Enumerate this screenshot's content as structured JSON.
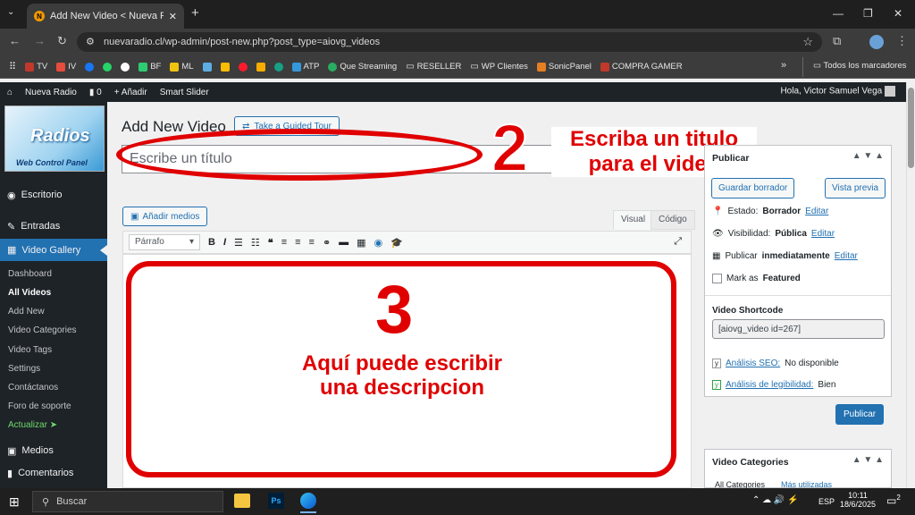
{
  "browser": {
    "tab_title": "Add New Video < Nueva Radio",
    "tab_favicon": "N",
    "new_tab": "+",
    "url": "nuevaradio.cl/wp-admin/post-new.php?post_type=aiovg_videos",
    "bookmarks": [
      "TV",
      "IV",
      "BF",
      "ML",
      "ATP",
      "Que Streaming",
      "RESELLER",
      "WP Clientes",
      "SonicPanel",
      "COMPRA GAMER"
    ],
    "bookmarks_more": "»",
    "all_bookmarks": "Todos los marcadores"
  },
  "adminbar": {
    "site": "Nueva Radio",
    "comments": "0",
    "new": "Añadir",
    "smart": "Smart Slider",
    "greeting": "Hola, Victor Samuel Vega"
  },
  "logo": {
    "text": "Radios",
    "subtitle": "Web Control Panel"
  },
  "sidebar": {
    "escritorio": "Escritorio",
    "entradas": "Entradas",
    "video_gallery": "Video Gallery",
    "subitems": [
      "Dashboard",
      "All Videos",
      "Add New",
      "Video Categories",
      "Video Tags",
      "Settings",
      "Contáctanos",
      "Foro de soporte"
    ],
    "actualizar": "Actualizar",
    "medios": "Medios",
    "comentarios": "Comentarios"
  },
  "main": {
    "heading": "Add New Video",
    "tour": "Take a Guided Tour",
    "title_placeholder": "Escribe un título",
    "add_media": "Añadir medios",
    "tab_visual": "Visual",
    "tab_code": "Código",
    "format": "Párrafo"
  },
  "annotations": {
    "num2": "2",
    "text2_line1": "Escriba un titulo",
    "text2_line2": "para el video",
    "num3": "3",
    "text3_line1": "Aquí puede escribir",
    "text3_line2": "una descripcion"
  },
  "publish": {
    "title": "Publicar",
    "save_draft": "Guardar borrador",
    "preview": "Vista previa",
    "status_label": "Estado:",
    "status_value": "Borrador",
    "edit": "Editar",
    "visibility_label": "Visibilidad:",
    "visibility_value": "Pública",
    "publish_label": "Publicar",
    "publish_value": "inmediatamente",
    "featured_pre": "Mark as",
    "featured": "Featured",
    "shortcode_label": "Video Shortcode",
    "shortcode_value": "[aiovg_video id=267]",
    "seo_label": "Análisis SEO:",
    "seo_value": "No disponible",
    "read_label": "Análisis de legibilidad:",
    "read_value": "Bien",
    "publish_btn": "Publicar"
  },
  "categories": {
    "title": "Video Categories",
    "tab_all": "All Categories",
    "tab_most": "Más utilizadas"
  },
  "taskbar": {
    "search": "Buscar",
    "lang": "ESP",
    "time": "10:11",
    "date": "18/6/2025",
    "notif": "2"
  },
  "colors": {
    "accent": "#2271b1",
    "annotation": "#e00000",
    "admin_dark": "#1d2327"
  }
}
